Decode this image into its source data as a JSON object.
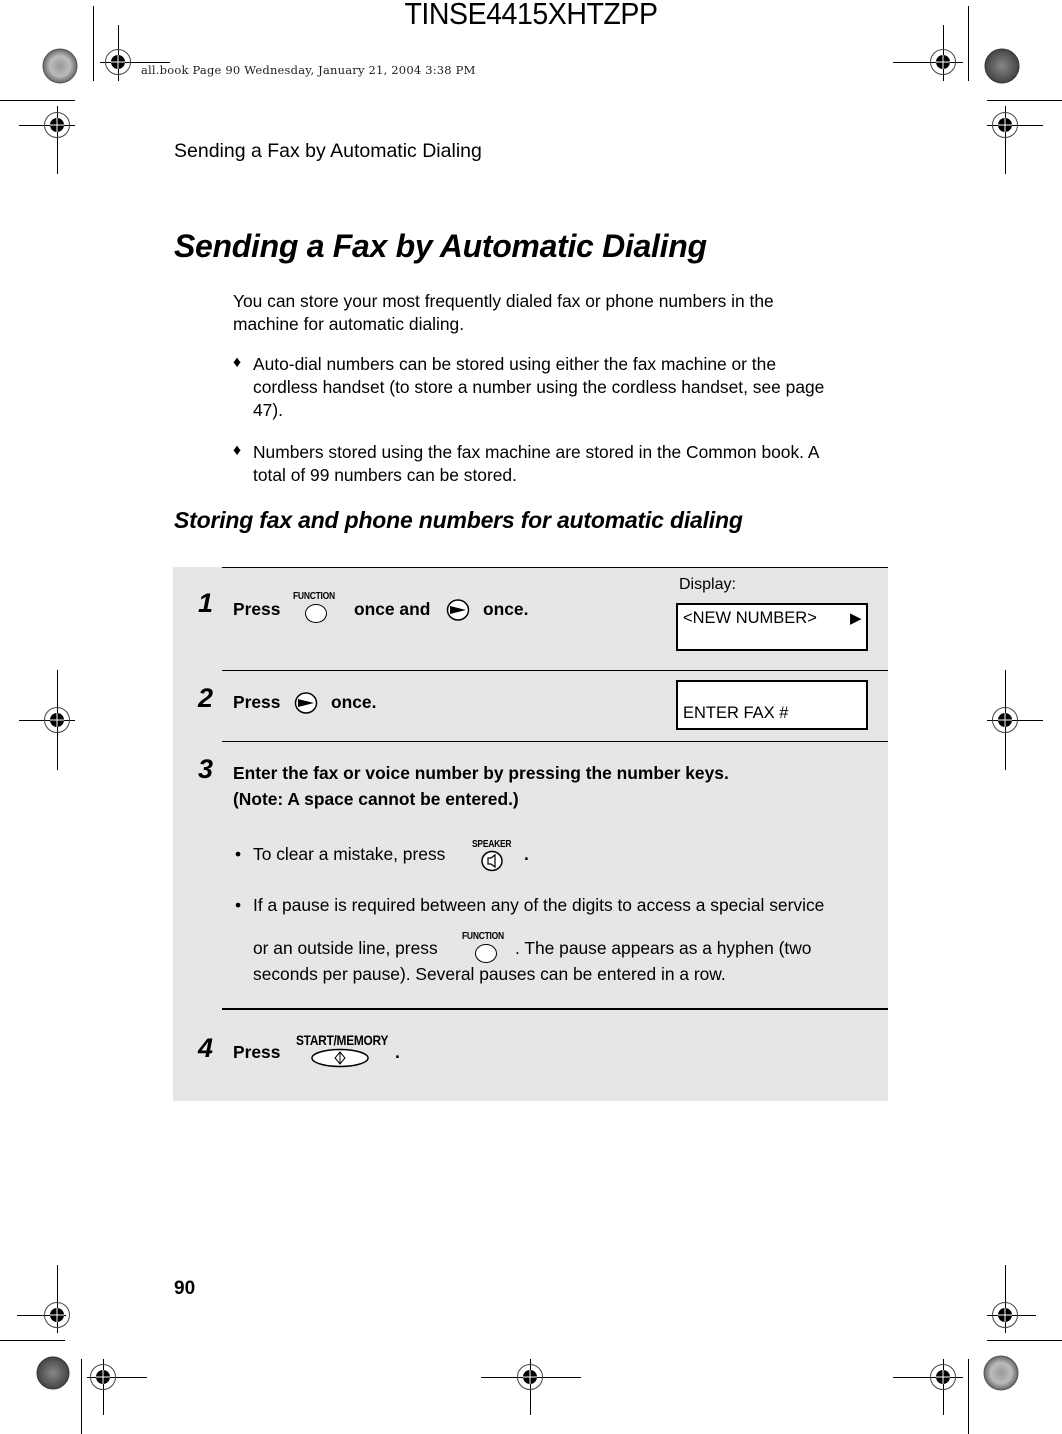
{
  "print_marks": {
    "job_id": "TINSE4415XHTZPP",
    "file_stamp": "all.book  Page 90  Wednesday, January 21, 2004  3:38 PM"
  },
  "running_head": "Sending a Fax by Automatic Dialing",
  "title": "Sending a Fax by Automatic Dialing",
  "intro": {
    "line1": "You can store your most frequently dialed fax or phone numbers in the",
    "line2": "machine for automatic dialing."
  },
  "bullets": [
    {
      "symbol": "♦",
      "lines": [
        "Auto-dial numbers can be stored using either the fax machine or the",
        "cordless handset (to store a number using the cordless handset, see page",
        "47)."
      ]
    },
    {
      "symbol": "♦",
      "lines": [
        "Numbers stored using the fax machine are stored in the Common book. A",
        "total of 99 numbers can be stored."
      ]
    }
  ],
  "subtitle": "Storing fax and phone numbers for automatic dialing",
  "display_label": "Display:",
  "steps": [
    {
      "number": "1",
      "text_press": "Press",
      "key1_label": "FUNCTION",
      "text_mid": "once and",
      "key2_icon": "right-arrow-key",
      "text_end": "once.",
      "display": "<NEW NUMBER>",
      "display_arrow": "▶"
    },
    {
      "number": "2",
      "text_press": "Press",
      "key_icon": "right-arrow-key",
      "text_end": "once.",
      "display": "ENTER FAX #"
    },
    {
      "number": "3",
      "line1": "Enter the fax or voice number by pressing the number keys.",
      "line2": "(Note: A space cannot be entered.)",
      "sub_bullets": [
        {
          "symbol": "•",
          "text_before": "To clear a mistake, press",
          "key_label": "SPEAKER",
          "text_after": "."
        },
        {
          "symbol": "•",
          "line1": "If a pause is required between any of the digits to access a special service",
          "text_before": "or an outside line, press",
          "key_label": "FUNCTION",
          "text_after": ". The pause appears as a hyphen (two",
          "line3": "seconds per pause). Several pauses can be entered in a row."
        }
      ]
    },
    {
      "number": "4",
      "text_press": "Press",
      "key_label": "START/MEMORY",
      "text_end": "."
    }
  ],
  "page_number": "90"
}
